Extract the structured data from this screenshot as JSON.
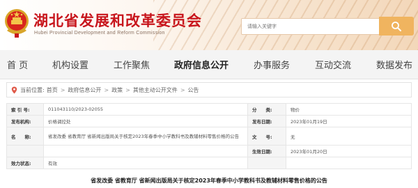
{
  "header": {
    "title": "湖北省发展和改革委员会",
    "subtitle": "Hubei Provincial Development and Reform Commission",
    "search_placeholder": "请输入关键字"
  },
  "nav": {
    "items": [
      "首 页",
      "机构设置",
      "工作聚焦",
      "政府信息公开",
      "办事服务",
      "互动交流",
      "数据发布"
    ],
    "active": "政府信息公开"
  },
  "breadcrumb": {
    "prefix": "当前位置:",
    "items": [
      "首页",
      "政府信息公开",
      "政策",
      "其他主动公开文件",
      "公告"
    ]
  },
  "info": {
    "rows": [
      {
        "label": "索 引 号:",
        "value": "011043110/2023-02055",
        "label2": "分　　类:",
        "value2": "物价"
      },
      {
        "label": "发布机构:",
        "value": "价格调控处",
        "label2": "发布日期:",
        "value2": "2023年01月19日"
      },
      {
        "label": "名　　称:",
        "value": "省发改委 省教育厅 省新闻出版局关于核定2023年春季中小学教科书及教辅材料零售价格的公告",
        "label2": "文　　号:",
        "value2": "无"
      },
      {
        "label": "",
        "value": "",
        "label2": "生效日期:",
        "value2": "2023年01月20日"
      },
      {
        "label": "效力状态:",
        "value": "有效",
        "label2": "",
        "value2": ""
      }
    ]
  },
  "document": {
    "title": "省发改委 省教育厅 省新闻出版局关于核定2023年春季中小学教科书及教辅材料零售价格的公告"
  },
  "colors": {
    "brand_red": "#c8161d",
    "search_button": "#f0b45f",
    "nav_background": "#f4f4f4"
  },
  "icons": [
    "national-emblem-icon",
    "search-icon",
    "location-icon"
  ]
}
